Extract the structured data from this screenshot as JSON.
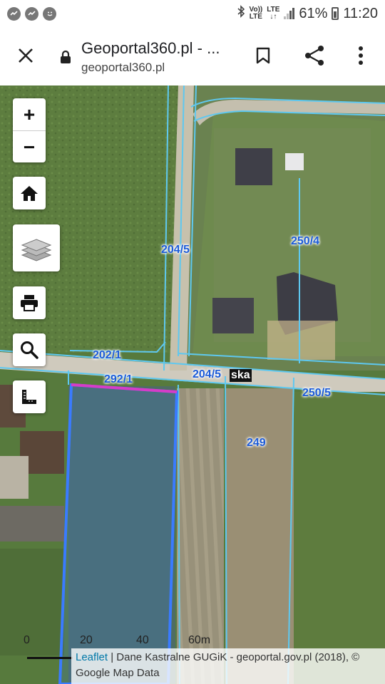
{
  "status_bar": {
    "volte": "Vo))",
    "volte_lte": "LTE",
    "lte": "LTE",
    "lte_arrows": "↓↑",
    "battery_percent": "61%",
    "time": "11:20"
  },
  "browser": {
    "title": "Geoportal360.pl - ...",
    "url": "geoportal360.pl"
  },
  "map": {
    "zoom_in": "+",
    "zoom_out": "−",
    "parcels": [
      "204/5",
      "250/4",
      "202/1",
      "292/1",
      "204/5",
      "250/5",
      "249"
    ],
    "street_label": "ska",
    "scale": {
      "labels": [
        "0",
        "20",
        "40",
        "60m"
      ]
    },
    "attribution": {
      "link": "Leaflet",
      "text": " | Dane Kastralne GUGiK - geoportal.gov.pl (2018), © Google Map Data"
    }
  },
  "colors": {
    "parcel_line": "#5ec8f0",
    "selected_parcel": "#3a7bff",
    "selected_edge": "#d63cc8"
  }
}
